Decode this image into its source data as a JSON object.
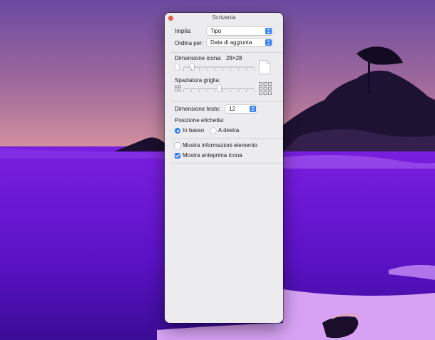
{
  "window": {
    "title": "Scrivania"
  },
  "stack_by": {
    "label": "Impila:",
    "value": "Tipo"
  },
  "sort_by": {
    "label": "Ordina per:",
    "value": "Data di aggiunta"
  },
  "icon_size": {
    "label": "Dimensione icona:",
    "value": "28×28",
    "slider_fraction": 0.1
  },
  "grid_spacing": {
    "label": "Spaziatura griglia:",
    "slider_fraction": 0.5
  },
  "text_size": {
    "label": "Dimensione testo:",
    "value": "12"
  },
  "label_position": {
    "label": "Posizione etichetta:",
    "options": [
      {
        "label": "In basso",
        "selected": true
      },
      {
        "label": "A destra",
        "selected": false
      }
    ]
  },
  "show_item_info": {
    "label": "Mostra informazioni elemento",
    "checked": false
  },
  "show_icon_preview": {
    "label": "Mostra anteprima icona",
    "checked": true
  },
  "colors": {
    "accent": "#2f7cf6",
    "close": "#ec5f57",
    "panel": "#ecebee"
  }
}
